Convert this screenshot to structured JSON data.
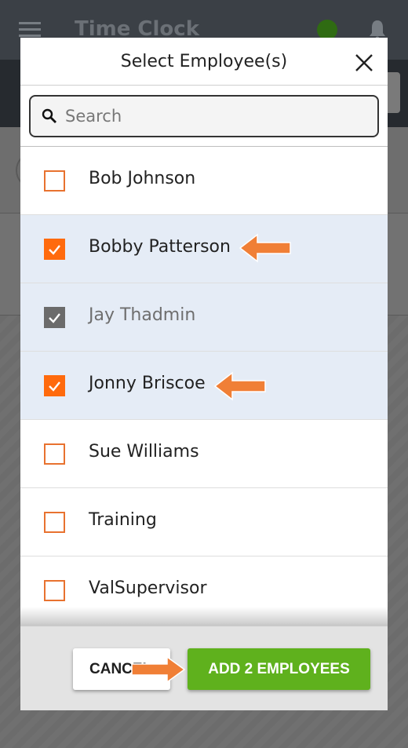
{
  "app": {
    "title": "Time Clock",
    "status_color": "#2f6b12"
  },
  "modal": {
    "title": "Select Employee(s)",
    "search": {
      "placeholder": "Search",
      "value": ""
    },
    "employees": [
      {
        "name": "Bob Johnson",
        "checked": false,
        "disabled": false
      },
      {
        "name": "Bobby Patterson",
        "checked": true,
        "disabled": false,
        "highlighted_by_arrow": true
      },
      {
        "name": "Jay Thadmin",
        "checked": true,
        "disabled": true
      },
      {
        "name": "Jonny Briscoe",
        "checked": true,
        "disabled": false,
        "highlighted_by_arrow": true
      },
      {
        "name": "Sue Williams",
        "checked": false,
        "disabled": false
      },
      {
        "name": "Training",
        "checked": false,
        "disabled": false
      },
      {
        "name": "ValSupervisor",
        "checked": false,
        "disabled": false
      }
    ],
    "footer": {
      "cancel_label": "CANCEL",
      "add_label": "ADD 2 EMPLOYEES"
    }
  },
  "colors": {
    "accent_orange": "#ff6a0d",
    "arrow_orange": "#f07f36",
    "primary_green": "#5fb11d",
    "selected_row": "#e5ecf6"
  },
  "icons": [
    "menu-icon",
    "bell-icon",
    "close-icon",
    "search-icon",
    "checkmark-icon",
    "arrow-left-icon",
    "arrow-right-icon"
  ]
}
